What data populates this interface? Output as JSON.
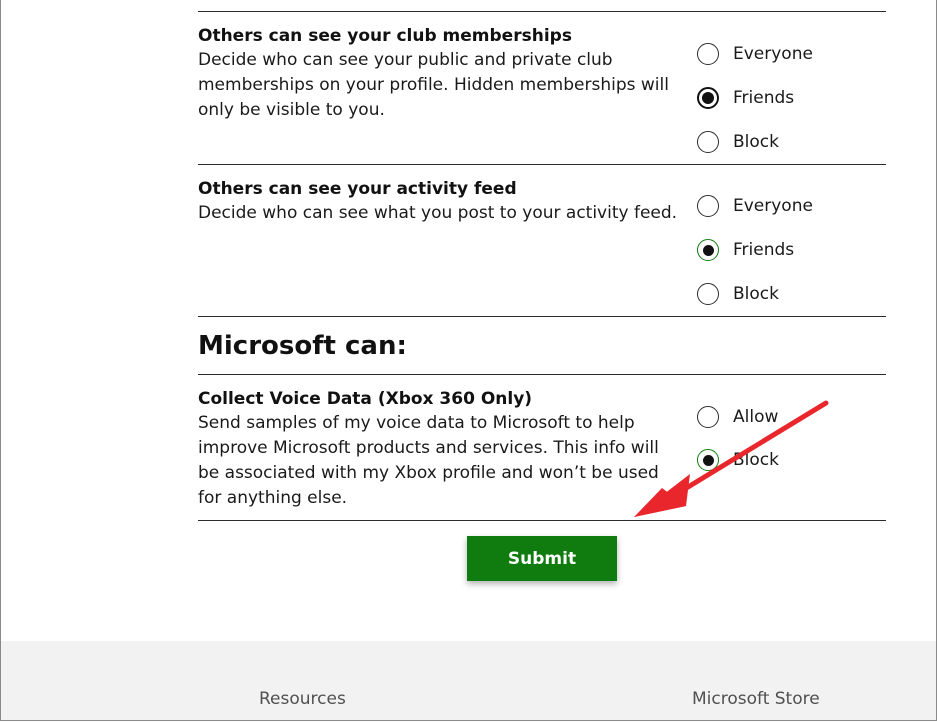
{
  "sections": [
    {
      "title": "Others can see your club memberships",
      "description": "Decide who can see your public and private club memberships on your profile. Hidden memberships will only be visible to you.",
      "options": [
        "Everyone",
        "Friends",
        "Block"
      ],
      "selected": "Friends"
    },
    {
      "title": "Others can see your activity feed",
      "description": "Decide who can see what you post to your activity feed.",
      "options": [
        "Everyone",
        "Friends",
        "Block"
      ],
      "selected": "Friends"
    }
  ],
  "microsoft_heading": "Microsoft can:",
  "voice": {
    "title": "Collect Voice Data (Xbox 360 Only)",
    "description": "Send samples of my voice data to Microsoft to help improve Microsoft products and services. This info will be associated with my Xbox profile and won’t be used for anything else.",
    "options": [
      "Allow",
      "Block"
    ],
    "selected": "Block"
  },
  "submit_label": "Submit",
  "footer": {
    "resources": "Resources",
    "store": "Microsoft Store"
  },
  "colors": {
    "submit_bg": "#107c10",
    "annotation_arrow": "#e8262b",
    "footer_bg": "#f2f2f2"
  }
}
